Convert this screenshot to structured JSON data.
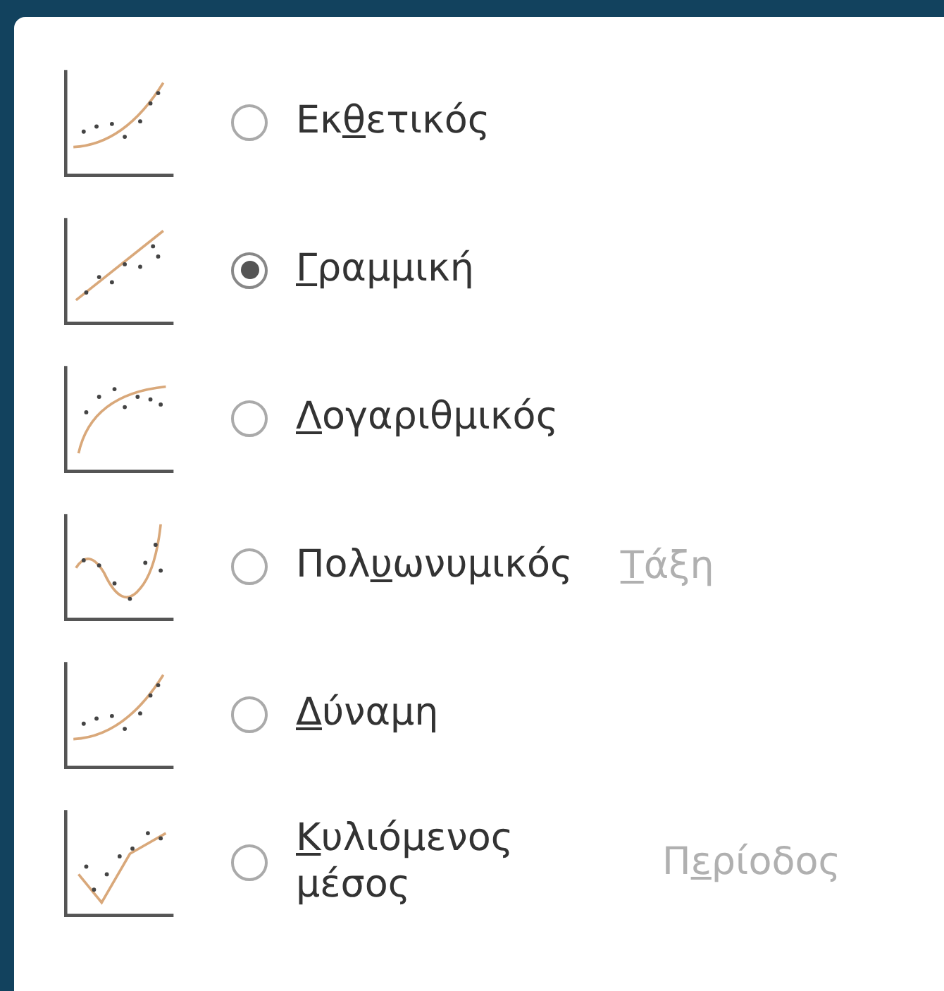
{
  "trendline_types": [
    {
      "kind": "exponential",
      "selected": false,
      "label": {
        "before": "Εκ",
        "key": "θ",
        "after": "ετικός"
      }
    },
    {
      "kind": "linear",
      "selected": true,
      "label": {
        "key": "Γ",
        "after": "ραμμική"
      }
    },
    {
      "kind": "logarithmic",
      "selected": false,
      "label": {
        "key": "Λ",
        "after": "ογαριθμικός"
      }
    },
    {
      "kind": "polynomial",
      "selected": false,
      "label": {
        "before": "Πολ",
        "key": "υ",
        "after": "ωνυμικός"
      },
      "option": {
        "disabled": true,
        "label": {
          "key": "Τ",
          "after": "άξη"
        }
      }
    },
    {
      "kind": "power",
      "selected": false,
      "label": {
        "key": "Δ",
        "after": "ύναμη"
      }
    },
    {
      "kind": "moving_average",
      "selected": false,
      "label": {
        "key": "Κ",
        "after": "υλιόμενος μέσος"
      },
      "option": {
        "disabled": true,
        "label": {
          "before": "Π",
          "key": "ε",
          "after": "ρίοδος"
        }
      }
    }
  ]
}
